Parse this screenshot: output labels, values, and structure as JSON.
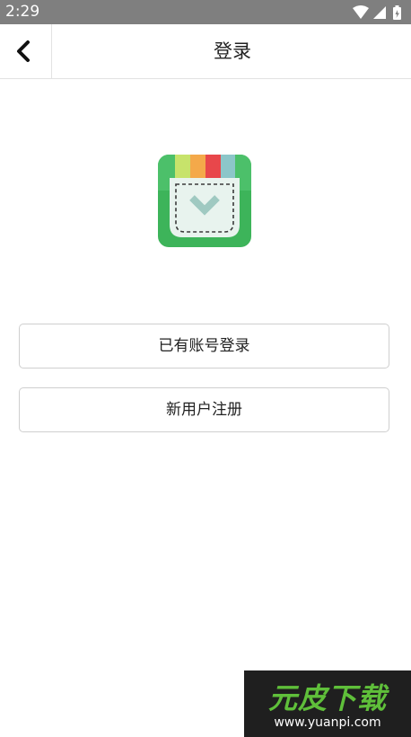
{
  "status_bar": {
    "time": "2:29",
    "icons": [
      "wifi-icon",
      "signal-icon",
      "battery-icon"
    ]
  },
  "app_bar": {
    "back_icon": "chevron-left-icon",
    "title": "登录"
  },
  "logo": {
    "icon": "pocket-download-icon",
    "colors": {
      "background": "#3db45a",
      "pocket": "#e8f3ee",
      "stripes": [
        "#c7e36b",
        "#f4a94a",
        "#e8474b",
        "#8cc6c9"
      ],
      "arrow": "#9fc9c1"
    }
  },
  "buttons": {
    "login_label": "已有账号登录",
    "register_label": "新用户注册"
  },
  "watermark": {
    "title": "元皮下载",
    "url": "www.yuanpi.com"
  }
}
